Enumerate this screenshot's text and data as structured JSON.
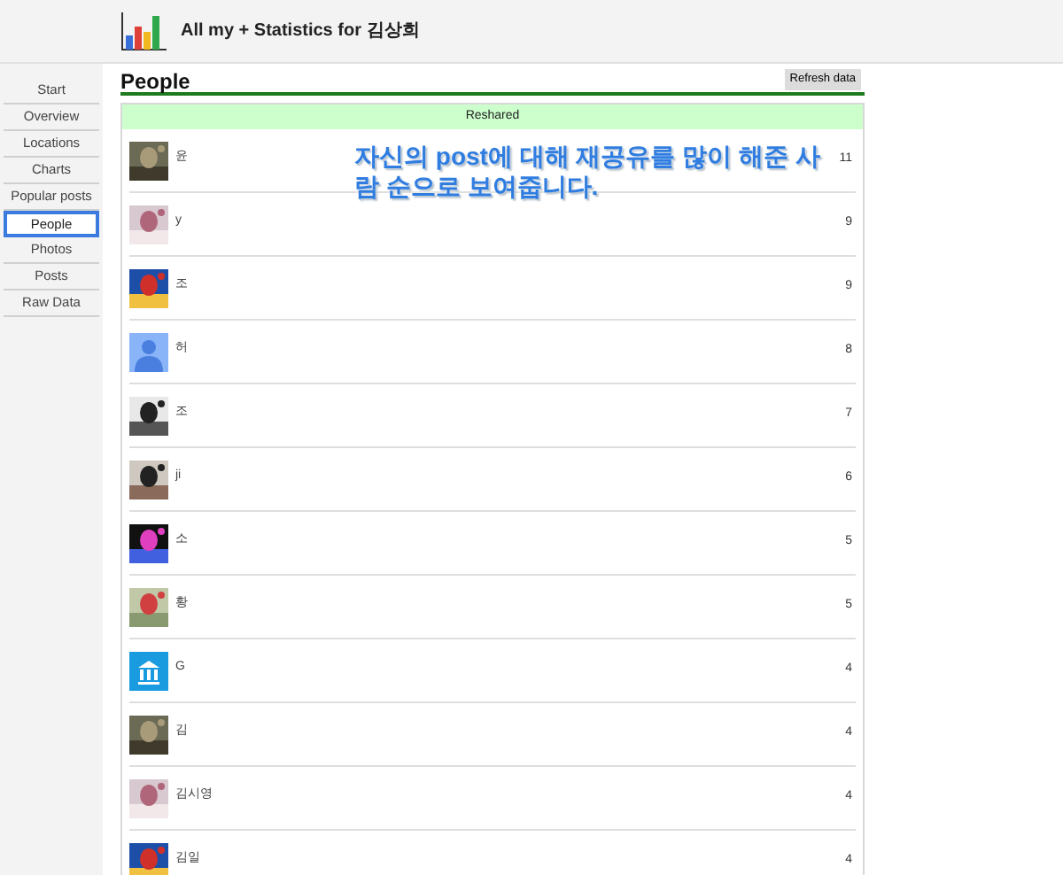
{
  "header": {
    "title": "All my + Statistics for 김상희"
  },
  "sidebar": {
    "items": [
      {
        "label": "Start",
        "selected": false
      },
      {
        "label": "Overview",
        "selected": false
      },
      {
        "label": "Locations",
        "selected": false
      },
      {
        "label": "Charts",
        "selected": false
      },
      {
        "label": "Popular posts",
        "selected": false
      },
      {
        "label": "People",
        "selected": true
      },
      {
        "label": "Photos",
        "selected": false
      },
      {
        "label": "Posts",
        "selected": false
      },
      {
        "label": "Raw Data",
        "selected": false
      }
    ]
  },
  "page": {
    "title": "People",
    "refresh_button": "Refresh data"
  },
  "table": {
    "column": "Reshared",
    "rows": [
      {
        "name": "윤",
        "count": "11"
      },
      {
        "name": "y",
        "count": "9"
      },
      {
        "name": "조",
        "count": "9"
      },
      {
        "kind": "person",
        "name": "허",
        "count": "8"
      },
      {
        "name": "조",
        "count": "7"
      },
      {
        "name": "ji",
        "count": "6"
      },
      {
        "name": "소",
        "count": "5"
      },
      {
        "name": "황",
        "count": "5"
      },
      {
        "kind": "institution",
        "name": "G",
        "count": "4"
      },
      {
        "name": "김",
        "count": "4"
      },
      {
        "name": "김시영",
        "count": "4"
      },
      {
        "name": "김일",
        "count": "4"
      }
    ]
  },
  "annotation": "자신의 post에 대해 재공유를 많이 해준 사람 순으로 보여줍니다."
}
